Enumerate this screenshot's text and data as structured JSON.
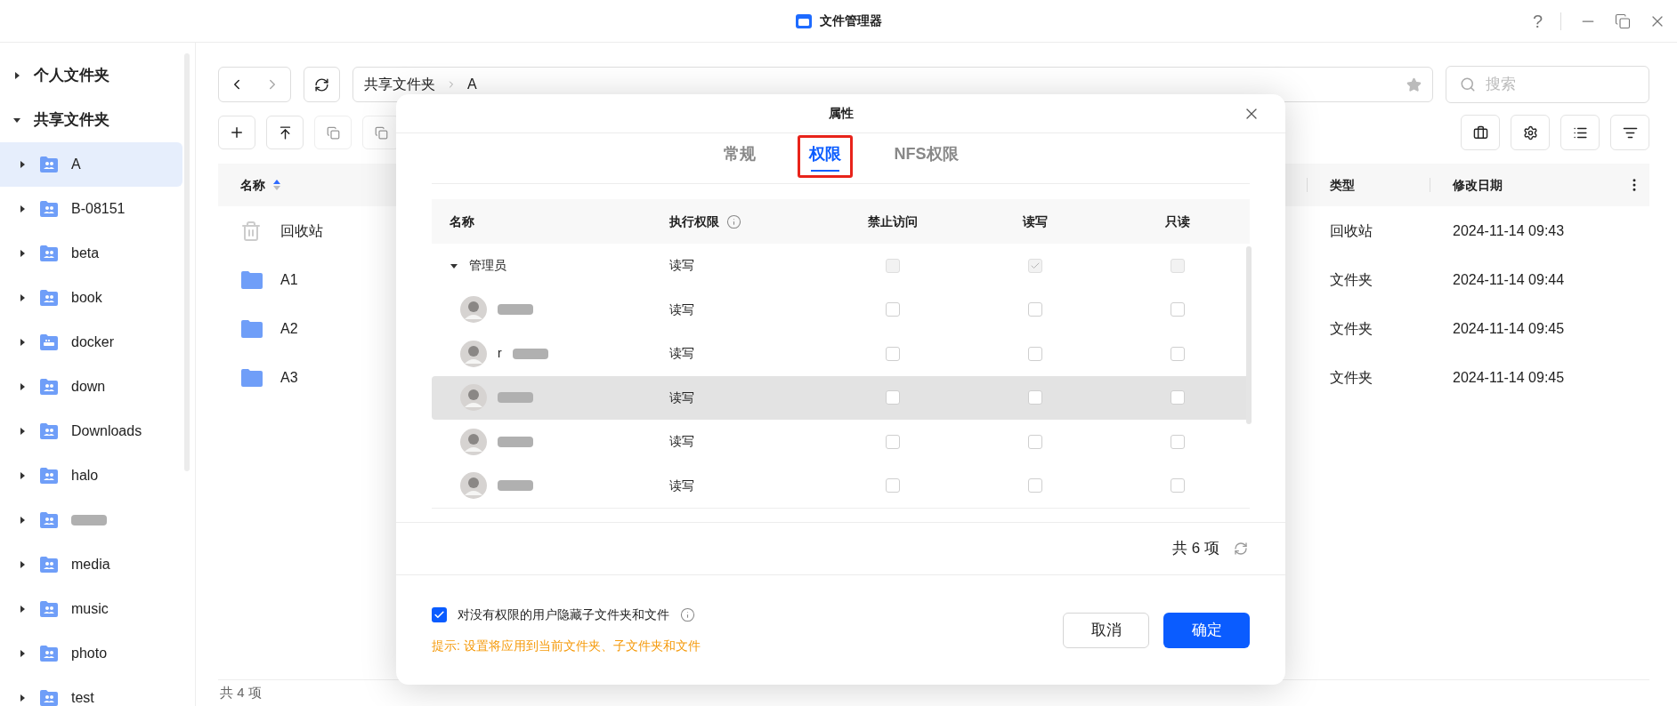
{
  "window": {
    "title": "文件管理器",
    "help": "?"
  },
  "sidebar": {
    "sections": [
      {
        "label": "个人文件夹",
        "expanded": false
      },
      {
        "label": "共享文件夹",
        "expanded": true,
        "children": [
          {
            "label": "A",
            "kind": "shared",
            "selected": true
          },
          {
            "label": "B-08151",
            "kind": "shared",
            "selected": false
          },
          {
            "label": "beta",
            "kind": "shared",
            "selected": false
          },
          {
            "label": "book",
            "kind": "shared",
            "selected": false
          },
          {
            "label": "docker",
            "kind": "docker",
            "selected": false
          },
          {
            "label": "down",
            "kind": "shared",
            "selected": false
          },
          {
            "label": "Downloads",
            "kind": "shared",
            "selected": false
          },
          {
            "label": "halo",
            "kind": "shared",
            "selected": false
          },
          {
            "kind": "shared",
            "redacted": true,
            "selected": false
          },
          {
            "label": "media",
            "kind": "shared",
            "selected": false
          },
          {
            "label": "music",
            "kind": "shared",
            "selected": false
          },
          {
            "label": "photo",
            "kind": "shared",
            "selected": false
          },
          {
            "label": "test",
            "kind": "shared",
            "selected": false
          }
        ]
      }
    ]
  },
  "breadcrumb": [
    "共享文件夹",
    "A"
  ],
  "search": {
    "placeholder": "搜索"
  },
  "file_table": {
    "columns": [
      "名称",
      "类型",
      "修改日期"
    ],
    "rows": [
      {
        "kind": "trash",
        "name": "回收站",
        "type": "回收站",
        "modified": "2024-11-14 09:43"
      },
      {
        "kind": "folder",
        "name": "A1",
        "type": "文件夹",
        "modified": "2024-11-14 09:44"
      },
      {
        "kind": "folder",
        "name": "A2",
        "type": "文件夹",
        "modified": "2024-11-14 09:45"
      },
      {
        "kind": "folder",
        "name": "A3",
        "type": "文件夹",
        "modified": "2024-11-14 09:45"
      }
    ]
  },
  "status_bar": "共 4 项",
  "dialog": {
    "title": "属性",
    "tabs": [
      {
        "label": "常规",
        "selected": false,
        "outlined": false
      },
      {
        "label": "权限",
        "selected": true,
        "outlined": true
      },
      {
        "label": "NFS权限",
        "selected": false,
        "outlined": false
      }
    ],
    "columns": [
      "名称",
      "执行权限",
      "禁止访问",
      "读写",
      "只读"
    ],
    "rows": [
      {
        "kind": "group",
        "name": "管理员",
        "expanded": true,
        "disabled": true,
        "exec": "读写",
        "deny": false,
        "read_write": true,
        "read_only": false,
        "hovered": false,
        "children": [
          {
            "kind": "user",
            "redacted": true,
            "disabled": false,
            "exec": "读写",
            "deny": false,
            "read_write": false,
            "read_only": false,
            "hovered": false
          },
          {
            "kind": "user",
            "name": "r",
            "redacted": true,
            "disabled": false,
            "exec": "读写",
            "deny": false,
            "read_write": false,
            "read_only": false,
            "hovered": false
          },
          {
            "kind": "user",
            "redacted": true,
            "disabled": false,
            "exec": "读写",
            "deny": false,
            "read_write": false,
            "read_only": false,
            "hovered": true
          },
          {
            "kind": "user",
            "redacted": true,
            "disabled": false,
            "exec": "读写",
            "deny": false,
            "read_write": false,
            "read_only": false,
            "hovered": false
          },
          {
            "kind": "user",
            "redacted": true,
            "disabled": false,
            "exec": "读写",
            "deny": false,
            "read_write": false,
            "read_only": false,
            "hovered": false
          }
        ]
      }
    ],
    "count": "共 6 项",
    "option": {
      "label": "对没有权限的用户隐藏子文件夹和文件",
      "checked": true
    },
    "hint": "提示: 设置将应用到当前文件夹、子文件夹和文件",
    "buttons": [
      {
        "label": "取消",
        "kind": "secondary"
      },
      {
        "label": "确定",
        "kind": "primary"
      }
    ]
  }
}
